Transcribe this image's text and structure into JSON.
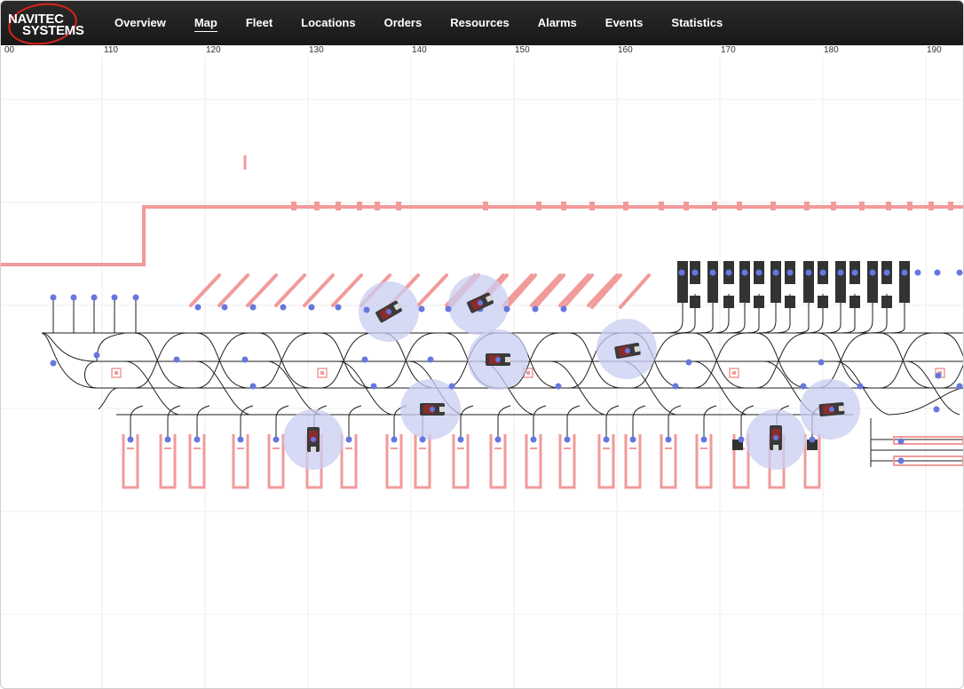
{
  "logo": {
    "line1": "NAVITEC",
    "line2": "SYSTEMS"
  },
  "nav": [
    {
      "label": "Overview",
      "active": false
    },
    {
      "label": "Map",
      "active": true
    },
    {
      "label": "Fleet",
      "active": false
    },
    {
      "label": "Locations",
      "active": false
    },
    {
      "label": "Orders",
      "active": false
    },
    {
      "label": "Resources",
      "active": false
    },
    {
      "label": "Alarms",
      "active": false
    },
    {
      "label": "Events",
      "active": false
    },
    {
      "label": "Statistics",
      "active": false
    }
  ],
  "ruler": {
    "labels": [
      "00",
      "110",
      "120",
      "130",
      "140",
      "150",
      "160",
      "170",
      "180",
      "190"
    ]
  },
  "colors": {
    "wall": "#f29a9a",
    "node": "#6677dd",
    "path": "#1e1e1e",
    "halo": "#c9cdf2",
    "dock": "#333333"
  }
}
